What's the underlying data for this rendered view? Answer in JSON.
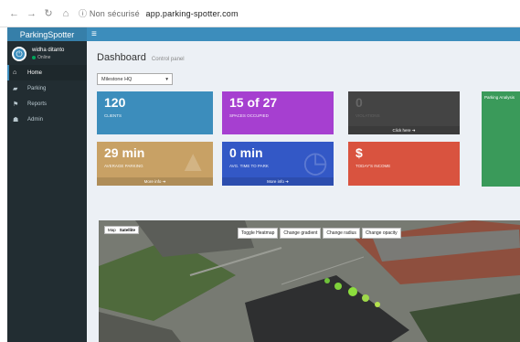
{
  "browser": {
    "address_prefix": "Non sécurisé",
    "address_url": "app.parking-spotter.com"
  },
  "app": {
    "brand": "ParkingSpotter",
    "menu_toggle": "≡"
  },
  "user": {
    "name": "widha ditanto",
    "status": "Online"
  },
  "sidebar": {
    "items": [
      {
        "label": "Home",
        "icon": "home-icon"
      },
      {
        "label": "Parking",
        "icon": "car-icon"
      },
      {
        "label": "Reports",
        "icon": "flag-icon"
      },
      {
        "label": "Admin",
        "icon": "user-icon"
      }
    ]
  },
  "page": {
    "title": "Dashboard",
    "subtitle": "Control panel"
  },
  "zone_select": {
    "value": "Milestone HQ"
  },
  "tiles": [
    {
      "value": "120",
      "label": "Clients",
      "color": "#3c8dbc"
    },
    {
      "value": "15 of 27",
      "label": "Spaces occupied",
      "color": "#a63fd0"
    },
    {
      "value": "0",
      "label": "Violations",
      "footer": "Click here",
      "color": "#444444"
    },
    {
      "value": "29 min",
      "label": "Average parking",
      "footer": "More info",
      "color": "#c8a165"
    },
    {
      "value": "0 min",
      "label": "Avg. time to park",
      "footer": "More info",
      "color": "#3358c6"
    },
    {
      "value": "$",
      "label": "Today's income",
      "color": "#d9533f"
    },
    {
      "value": "Parking Analysis",
      "color": "#3a9a5a"
    }
  ],
  "map": {
    "type_options": [
      "Map",
      "Satellite"
    ],
    "buttons": [
      "Toggle Heatmap",
      "Change gradient",
      "Change radius",
      "Change opacity"
    ]
  }
}
